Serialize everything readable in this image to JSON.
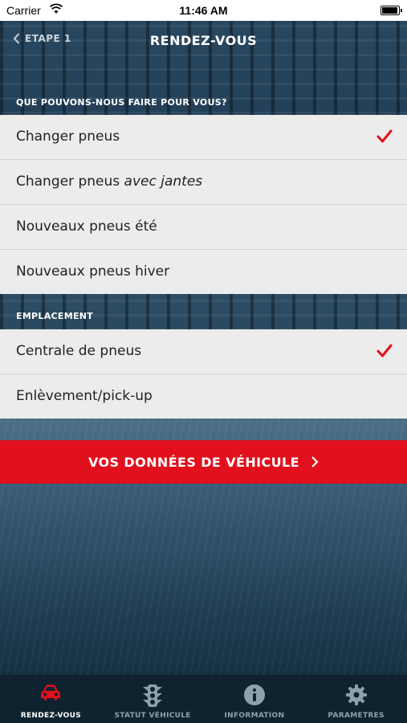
{
  "status_bar": {
    "carrier": "Carrier",
    "time": "11:46 AM"
  },
  "nav": {
    "back_label": "ETAPE 1",
    "title": "RENDEZ-VOUS"
  },
  "services": {
    "heading": "QUE POUVONS-NOUS FAIRE POUR VOUS?",
    "items": [
      {
        "label": "Changer pneus",
        "emphasis": "",
        "selected": true
      },
      {
        "label": "Changer pneus ",
        "emphasis": "avec jantes",
        "selected": false
      },
      {
        "label": "Nouveaux pneus été",
        "emphasis": "",
        "selected": false
      },
      {
        "label": "Nouveaux pneus hiver",
        "emphasis": "",
        "selected": false
      }
    ]
  },
  "location": {
    "heading": "EMPLACEMENT",
    "items": [
      {
        "label": "Centrale de pneus",
        "selected": true
      },
      {
        "label": "Enlèvement/pick-up",
        "selected": false
      }
    ]
  },
  "cta": {
    "label": "VOS DONNÉES DE VÉHICULE"
  },
  "tabs": [
    {
      "label": "RENDEZ-VOUS",
      "icon": "car-icon",
      "active": true
    },
    {
      "label": "STATUT VÉHICULE",
      "icon": "traffic-light-icon",
      "active": false
    },
    {
      "label": "INFORMATION",
      "icon": "info-icon",
      "active": false
    },
    {
      "label": "PARAMETRES",
      "icon": "gear-icon",
      "active": false
    }
  ],
  "colors": {
    "accent": "#e1101c",
    "list_bg": "#ececec",
    "tabbar_bg": "#0f2230"
  }
}
